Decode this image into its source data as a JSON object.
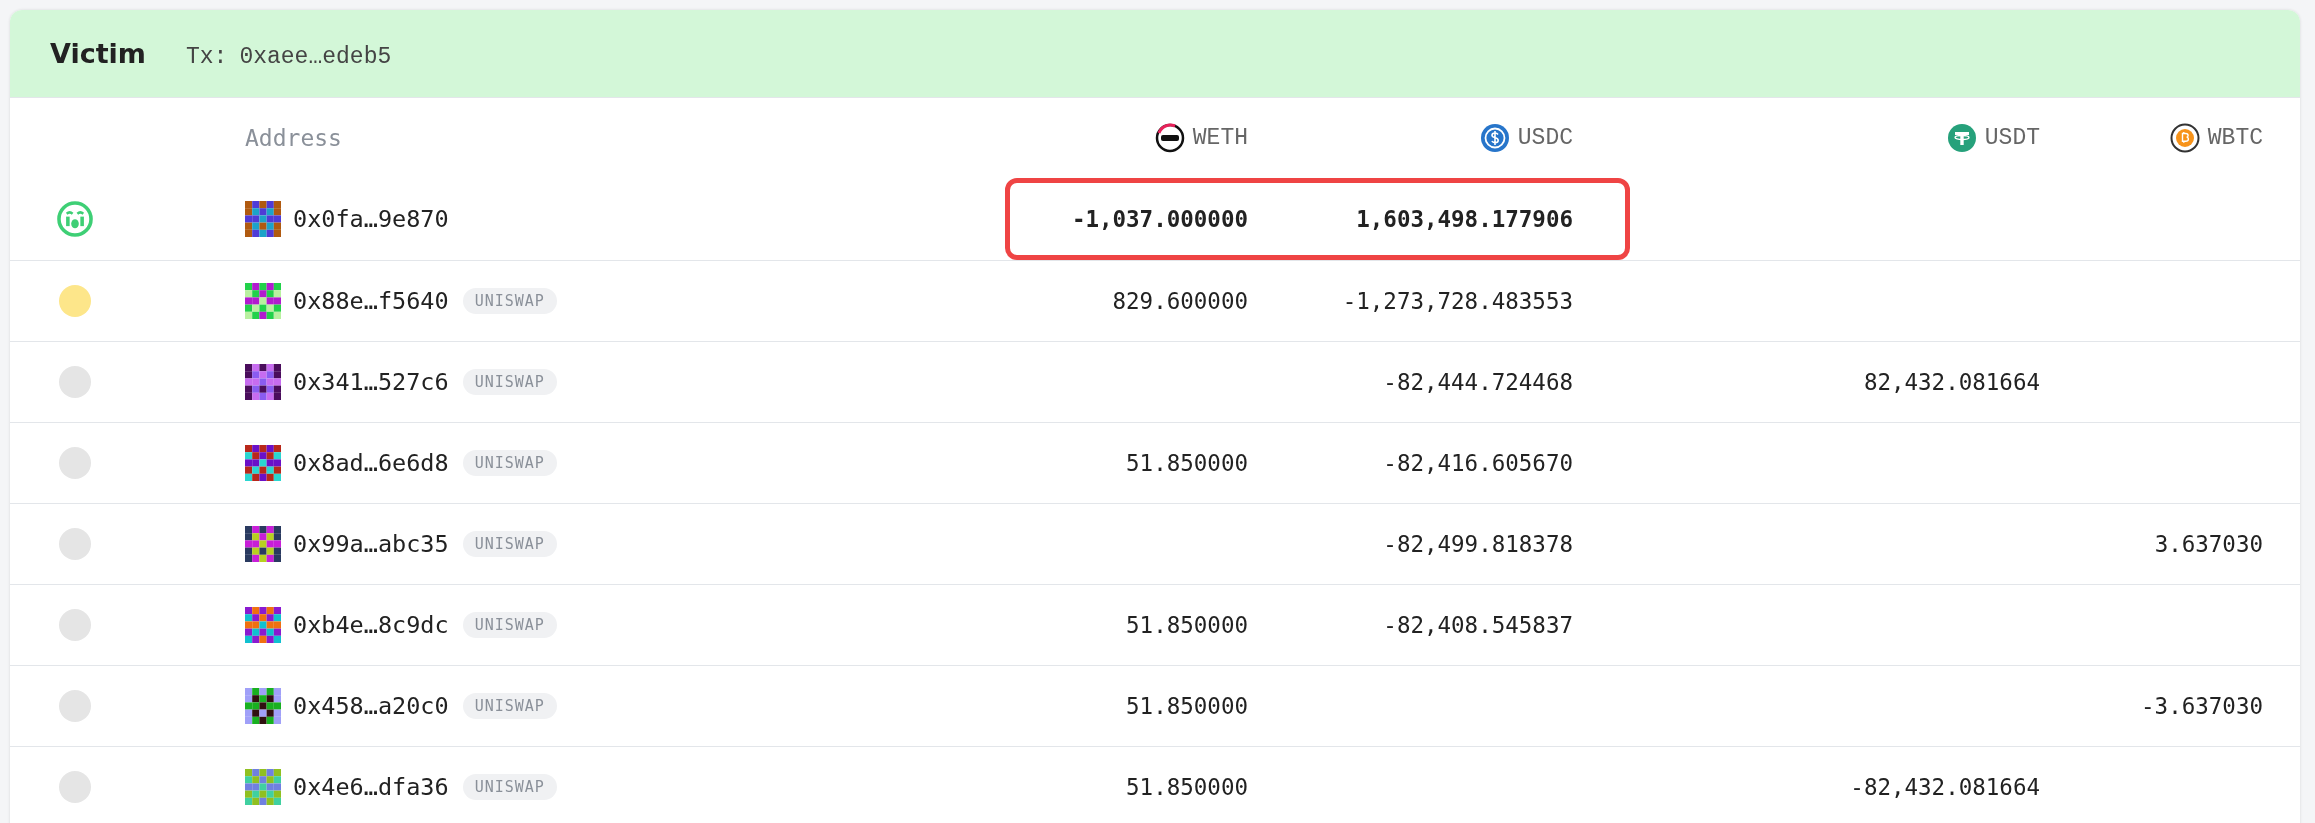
{
  "panel": {
    "title": "Victim",
    "tx_label": "Tx:",
    "tx_hash": "0xaee…edeb5"
  },
  "table": {
    "address_header": "Address",
    "tokens": [
      {
        "symbol": "WETH",
        "kind": "weth"
      },
      {
        "symbol": "USDC",
        "kind": "usdc"
      },
      {
        "symbol": "USDT",
        "kind": "usdt"
      },
      {
        "symbol": "WBTC",
        "kind": "wbtc"
      }
    ],
    "rows": [
      {
        "kind": "face",
        "address": "0x0fa…9e870",
        "highlighted": true,
        "values": {
          "weth": "-1,037.000000",
          "usdc": "1,603,498.177906"
        }
      },
      {
        "kind": "dot",
        "color": "#fde68a",
        "address": "0x88e…f5640",
        "tag": "UNISWAP",
        "highlighted": false,
        "values": {
          "weth": "829.600000",
          "usdc": "-1,273,728.483553"
        }
      },
      {
        "kind": "dot",
        "color": "#e5e5e5",
        "address": "0x341…527c6",
        "tag": "UNISWAP",
        "highlighted": false,
        "values": {
          "usdc": "-82,444.724468",
          "usdt": "82,432.081664"
        }
      },
      {
        "kind": "dot",
        "color": "#e5e5e5",
        "address": "0x8ad…6e6d8",
        "tag": "UNISWAP",
        "highlighted": false,
        "values": {
          "weth": "51.850000",
          "usdc": "-82,416.605670"
        }
      },
      {
        "kind": "dot",
        "color": "#e5e5e5",
        "address": "0x99a…abc35",
        "tag": "UNISWAP",
        "highlighted": false,
        "values": {
          "usdc": "-82,499.818378",
          "wbtc": "3.637030"
        }
      },
      {
        "kind": "dot",
        "color": "#e5e5e5",
        "address": "0xb4e…8c9dc",
        "tag": "UNISWAP",
        "highlighted": false,
        "values": {
          "weth": "51.850000",
          "usdc": "-82,408.545837"
        }
      },
      {
        "kind": "dot",
        "color": "#e5e5e5",
        "address": "0x458…a20c0",
        "tag": "UNISWAP",
        "highlighted": false,
        "values": {
          "weth": "51.850000",
          "wbtc": "-3.637030"
        }
      },
      {
        "kind": "dot",
        "color": "#e5e5e5",
        "address": "0x4e6…dfa36",
        "tag": "UNISWAP",
        "highlighted": false,
        "values": {
          "weth": "51.850000",
          "usdt": "-82,432.081664"
        }
      }
    ]
  }
}
